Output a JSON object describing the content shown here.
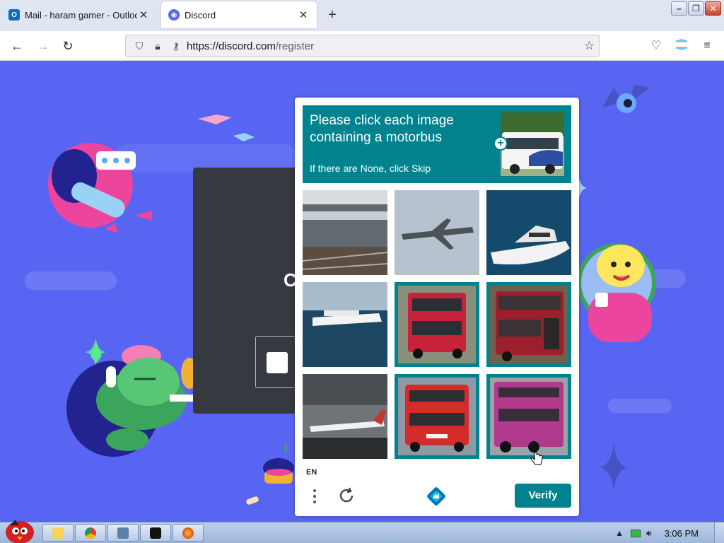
{
  "browser": {
    "tabs": [
      {
        "title": "Mail - haram gamer - Outlook",
        "favicon": "outlook-icon",
        "active": false
      },
      {
        "title": "Discord",
        "favicon": "discord-icon",
        "active": true
      }
    ],
    "new_tab": "+",
    "url_host": "https://discord.com",
    "url_path": "/register"
  },
  "captcha": {
    "prompt_line1": "Please click each image",
    "prompt_line2": "containing a motorbus",
    "skip_hint": "If there are None, click Skip",
    "language": "EN",
    "verify_label": "Verify",
    "tiles": [
      {
        "subject": "train",
        "selected": false
      },
      {
        "subject": "airplane",
        "selected": false
      },
      {
        "subject": "yacht",
        "selected": false
      },
      {
        "subject": "ship",
        "selected": false
      },
      {
        "subject": "bus",
        "selected": true
      },
      {
        "subject": "bus",
        "selected": true
      },
      {
        "subject": "airplane",
        "selected": false
      },
      {
        "subject": "bus",
        "selected": true
      },
      {
        "subject": "bus",
        "selected": true
      }
    ],
    "accent_color": "#00838f"
  },
  "page": {
    "background_color": "#5865f2"
  },
  "taskbar": {
    "clock": "3:06 PM",
    "pinned": [
      "explorer-icon",
      "chrome-icon",
      "media-icon",
      "cmd-icon",
      "firefox-icon"
    ]
  }
}
